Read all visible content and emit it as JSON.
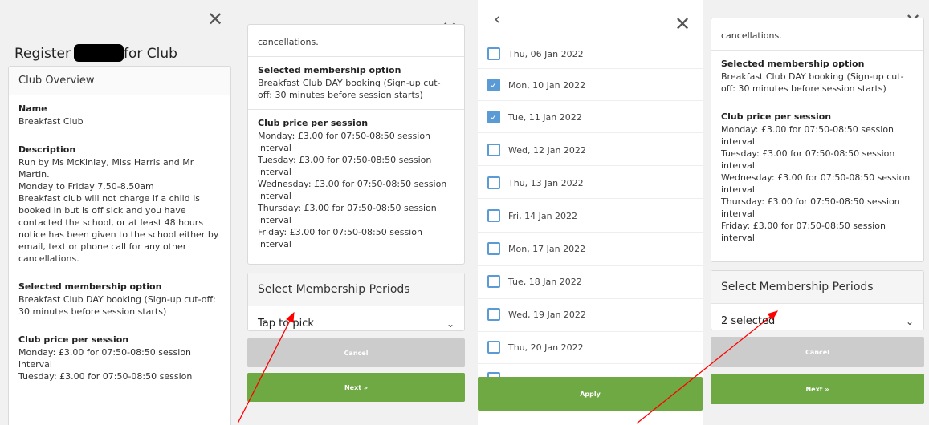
{
  "close_glyph": "✕",
  "back_glyph": "‹",
  "chevron_glyph": "⌄",
  "check_glyph": "✓",
  "panel1": {
    "title_before": "Register",
    "title_after": "for Club",
    "overview_header": "Club Overview",
    "name_label": "Name",
    "name_value": "Breakfast Club",
    "description_label": "Description",
    "description_text": "Run by Ms McKinlay, Miss Harris and Mr Martin.\nMonday to Friday 7.50-8.50am\nBreakfast club will not charge if a child is booked in but is off sick and you have contacted the school, or at least 48 hours notice has been given to the school either by email, text or phone call for any other cancellations.",
    "option_label": "Selected membership option",
    "option_text": "Breakfast Club DAY booking (Sign-up cut-off: 30 minutes before session starts)",
    "price_label": "Club price per session",
    "price_text": "Monday: £3.00 for 07:50-08:50 session interval\nTuesday: £3.00 for 07:50-08:50 session"
  },
  "panel2": {
    "top_text": "cancellations.",
    "option_label": "Selected membership option",
    "option_text": "Breakfast Club DAY booking (Sign-up cut-off: 30 minutes before session starts)",
    "price_label": "Club price per session",
    "price_text": "Monday: £3.00 for 07:50-08:50 session interval\nTuesday: £3.00 for 07:50-08:50 session interval\nWednesday: £3.00 for 07:50-08:50 session interval\nThursday: £3.00 for 07:50-08:50 session interval\nFriday: £3.00 for 07:50-08:50 session interval",
    "periods_title": "Select Membership Periods",
    "select_value": "Tap to pick",
    "cancel_label": "Cancel",
    "next_label": "Next »"
  },
  "panel3": {
    "dates": [
      {
        "label": "Thu, 06 Jan 2022",
        "checked": false
      },
      {
        "label": "Mon, 10 Jan 2022",
        "checked": true
      },
      {
        "label": "Tue, 11 Jan 2022",
        "checked": true
      },
      {
        "label": "Wed, 12 Jan 2022",
        "checked": false
      },
      {
        "label": "Thu, 13 Jan 2022",
        "checked": false
      },
      {
        "label": "Fri, 14 Jan 2022",
        "checked": false
      },
      {
        "label": "Mon, 17 Jan 2022",
        "checked": false
      },
      {
        "label": "Tue, 18 Jan 2022",
        "checked": false
      },
      {
        "label": "Wed, 19 Jan 2022",
        "checked": false
      },
      {
        "label": "Thu, 20 Jan 2022",
        "checked": false
      }
    ],
    "apply_label": "Apply"
  },
  "panel4": {
    "top_text": "cancellations.",
    "option_label": "Selected membership option",
    "option_text": "Breakfast Club DAY booking (Sign-up cut-off: 30 minutes before session starts)",
    "price_label": "Club price per session",
    "price_text": "Monday: £3.00 for 07:50-08:50 session interval\nTuesday: £3.00 for 07:50-08:50 session interval\nWednesday: £3.00 for 07:50-08:50 session interval\nThursday: £3.00 for 07:50-08:50 session interval\nFriday: £3.00 for 07:50-08:50 session interval",
    "periods_title": "Select Membership Periods",
    "select_value": "2 selected",
    "cancel_label": "Cancel",
    "next_label": "Next »"
  },
  "colors": {
    "next_green": "#6ea943",
    "cancel_grey": "#cccccc",
    "checkbox_blue": "#5b9bd5",
    "annotation_red": "#ff0000"
  }
}
